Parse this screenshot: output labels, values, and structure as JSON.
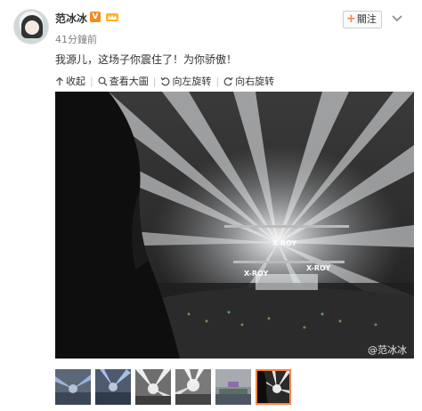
{
  "post": {
    "username": "范冰冰",
    "verified_badge": "V",
    "member_icon": "crown-icon",
    "time": "41分鐘前",
    "text": "我源儿，这场子你震住了！为你骄傲！",
    "follow_label": "關注",
    "more_icon": "chevron-down-icon"
  },
  "toolbar": {
    "collapse": "收起",
    "view_large": "查看大圖",
    "rotate_left": "向左旋转",
    "rotate_right": "向右旋转"
  },
  "photo": {
    "watermark": "@范冰冰",
    "stage_labels": [
      "X-ROY",
      "X-ROY",
      "X-ROY"
    ]
  },
  "thumbnails": {
    "count": 6,
    "selected_index": 5
  },
  "colors": {
    "accent": "#ff8140",
    "verified": "#f78a1d"
  }
}
